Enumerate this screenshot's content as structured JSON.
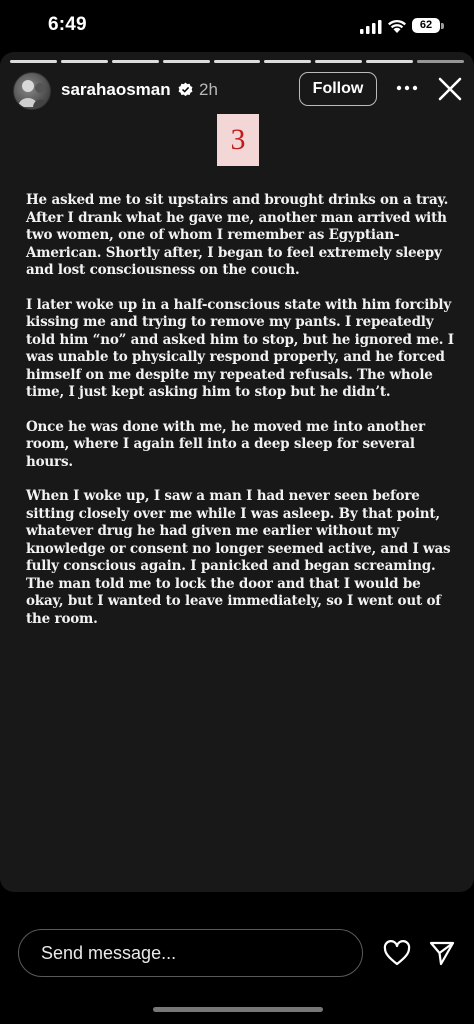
{
  "status_bar": {
    "time": "6:49",
    "battery": "62",
    "icons": [
      "signal-icon",
      "wifi-icon",
      "battery-icon"
    ]
  },
  "story": {
    "progress_segments": 9,
    "current_segment": 8,
    "header": {
      "username": "sarahaosman",
      "time_ago": "2h",
      "follow_label": "Follow",
      "icons": [
        "verified-badge-icon",
        "more-icon",
        "close-icon"
      ]
    },
    "page_number": "3",
    "paragraphs": [
      "He asked me to sit upstairs and brought drinks on a tray. After I drank what he gave me, another man arrived with two women, one of whom I remember as Egyptian-American. Shortly after, I began to feel extremely sleepy and lost consciousness on the couch.",
      "I later woke up in a half-conscious state with him forcibly kissing me and trying to remove my pants. I repeatedly told him “no” and asked him to stop, but he ignored me. I was unable to physically respond properly, and he forced himself on me despite my repeated refusals. The whole time, I just kept asking him to stop but he didn’t.",
      "Once he was done with me, he moved me into another room, where I again fell into a deep sleep for several hours.",
      "When I woke up, I saw a man I had never seen before sitting closely over me while I was asleep. By that point, whatever drug he had given me earlier without my knowledge or consent no longer seemed active, and I was fully conscious again. I panicked and began screaming. The man told me to lock the door and that I would be okay, but I wanted to leave immediately, so I went out of the room."
    ]
  },
  "reply": {
    "placeholder": "Send message...",
    "icons": [
      "heart-icon",
      "share-icon"
    ]
  },
  "colors": {
    "story_bg": "#181818",
    "badge_bg": "#f3d6d6",
    "badge_text": "#c21b1b"
  }
}
